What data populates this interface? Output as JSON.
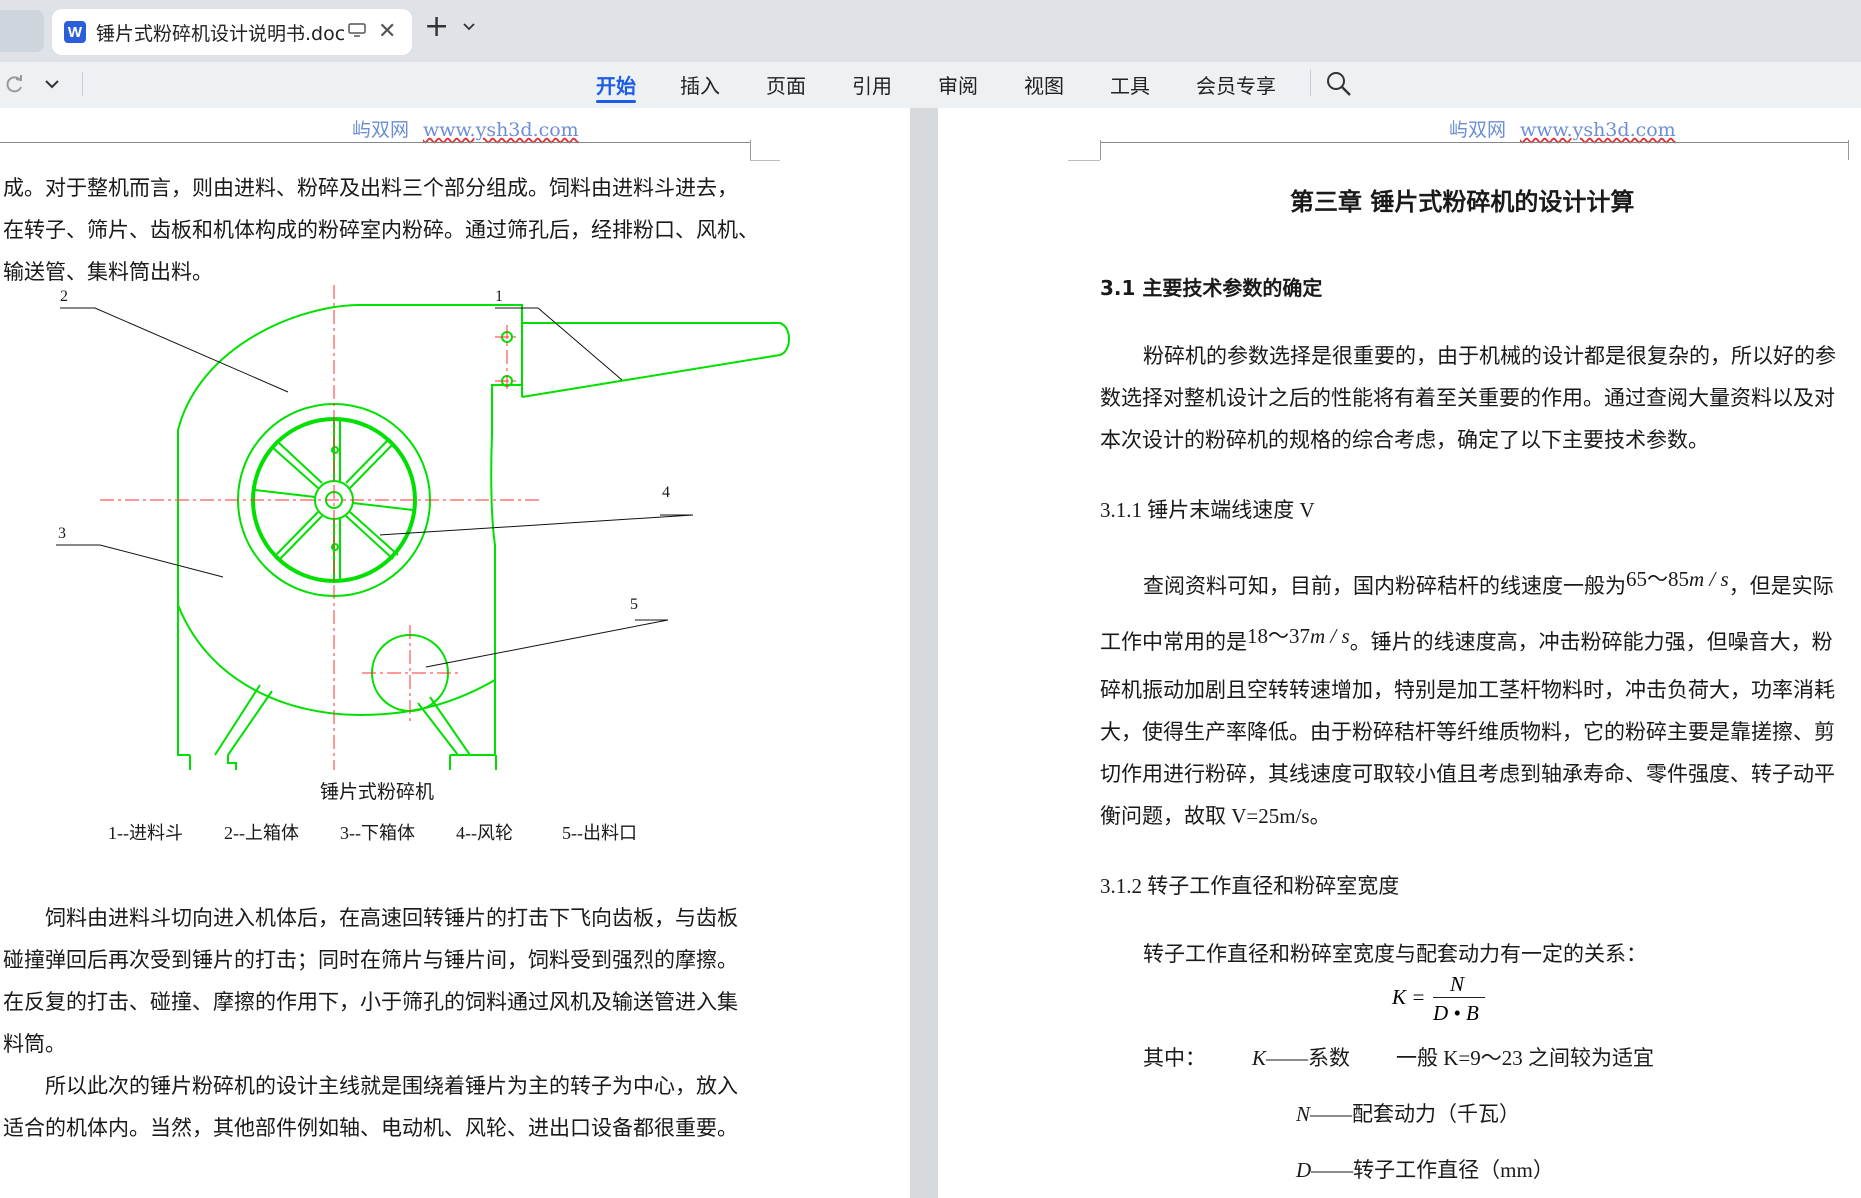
{
  "tab": {
    "title": "锤片式粉碎机设计说明书.doc",
    "app_letter": "W"
  },
  "ribbon": {
    "tabs": [
      "开始",
      "插入",
      "页面",
      "引用",
      "审阅",
      "视图",
      "工具",
      "会员专享"
    ],
    "active": "开始"
  },
  "header": {
    "site": "屿双网",
    "url": "www.ysh3d.com"
  },
  "left_page": {
    "intro": [
      "成。对于整机而言，则由进料、粉碎及出料三个部分组成。饲料由进料斗进去，",
      "在转子、筛片、齿板和机体构成的粉碎室内粉碎。通过筛孔后，经排粉口、风机、",
      "输送管、集料筒出料。"
    ],
    "drawing_labels": [
      "1",
      "2",
      "3",
      "4",
      "5"
    ],
    "figure_caption": "锤片式粉碎机",
    "legend": [
      "1--进料斗",
      "2--上箱体",
      "3--下箱体",
      "4--风轮",
      "5--出料口"
    ],
    "para1": [
      "饲料由进料斗切向进入机体后，在高速回转锤片的打击下飞向齿板，与齿板",
      "碰撞弹回后再次受到锤片的打击；同时在筛片与锤片间，饲料受到强烈的摩擦。",
      "在反复的打击、碰撞、摩擦的作用下，小于筛孔的饲料通过风机及输送管进入集",
      "料筒。"
    ],
    "para2": [
      "所以此次的锤片粉碎机的设计主线就是围绕着锤片为主的转子为中心，放入",
      "适合的机体内。当然，其他部件例如轴、电动机、风轮、进出口设备都很重要。"
    ]
  },
  "right_page": {
    "chapter_title": "第三章  锤片式粉碎机的设计计算",
    "section_31": "3.1  主要技术参数的确定",
    "p31": [
      "粉碎机的参数选择是很重要的，由于机械的设计都是很复杂的，所以好的参",
      "数选择对整机设计之后的性能将有着至关重要的作用。通过查阅大量资料以及对",
      "本次设计的粉碎机的规格的综合考虑，确定了以下主要技术参数。"
    ],
    "section_311": "3.1.1  锤片末端线速度 V",
    "p311": {
      "l1_pre": "查阅资料可知，目前，国内粉碎秸杆的线速度一般为",
      "l1_math": "65～85",
      "l1_unit": "m / s",
      "l1_post": "，但是实际",
      "l2_pre": "工作中常用的是",
      "l2_math": "18～37",
      "l2_unit": "m / s",
      "l2_post": "。锤片的线速度高，冲击粉碎能力强，但噪音大，粉",
      "rest": [
        "碎机振动加剧且空转转速增加，特别是加工茎杆物料时，冲击负荷大，功率消耗",
        "大，使得生产率降低。由于粉碎秸杆等纤维质物料，它的粉碎主要是靠搓擦、剪",
        "切作用进行粉碎，其线速度可取较小值且考虑到轴承寿命、零件强度、转子动平",
        "衡问题，故取 V=25m/s。"
      ]
    },
    "section_312": "3.1.2  转子工作直径和粉碎室宽度",
    "p312": "转子工作直径和粉碎室宽度与配套动力有一定的关系：",
    "formula": {
      "lhs": "K =",
      "num": "N",
      "den": "D • B"
    },
    "where": {
      "label": "其中：",
      "k_sym": "K",
      "k_desc": "——系数",
      "k_note": "一般 K=9～23 之间较为适宜",
      "n_sym": "N",
      "n_desc": "——配套动力（千瓦）",
      "d_sym": "D",
      "d_desc": "——转子工作直径（mm）"
    }
  },
  "colors": {
    "accent": "#1d5ce6",
    "drawing_green": "#00e000",
    "centerline_red": "#ff3030"
  }
}
